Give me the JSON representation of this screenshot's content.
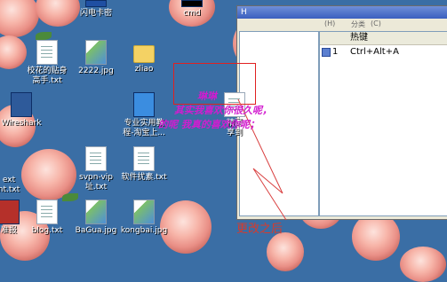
{
  "desktop": {
    "icons": [
      {
        "label": "闪电卡密",
        "type": "exe"
      },
      {
        "label": "cmd",
        "type": "exe"
      },
      {
        "label": "校花的贴身\n高手.txt",
        "type": "doc"
      },
      {
        "label": "2222.jpg",
        "type": "img"
      },
      {
        "label": "zliao",
        "type": "folder"
      },
      {
        "label": "Wireshark",
        "type": "exe"
      },
      {
        "label": "专业实用教\n程-淘宝上...",
        "type": "exe"
      },
      {
        "label": "精哥\n享到",
        "type": "doc"
      },
      {
        "label": "ext\nnt.txt",
        "type": "doc"
      },
      {
        "label": "svpn-vip\n址.txt",
        "type": "doc"
      },
      {
        "label": "软件扰素.txt",
        "type": "doc"
      },
      {
        "label": "准报",
        "type": "exe"
      },
      {
        "label": "blog.txt",
        "type": "doc"
      },
      {
        "label": "BaGua.jpg",
        "type": "img"
      },
      {
        "label": "kongbai.jpg",
        "type": "img"
      }
    ]
  },
  "window": {
    "title": "H",
    "menu": [
      "(H)",
      "分类",
      "(C)"
    ],
    "list": {
      "header": "热键",
      "rows": [
        {
          "index": "1",
          "hotkey": "Ctrl+Alt+A"
        }
      ]
    }
  },
  "annotation": {
    "handwriting": {
      "line1": "琳琳",
      "line2": "其实我喜欢你很久呢，",
      "line3": "的呢  我真的喜欢你呢；"
    },
    "caption": "更改之后"
  },
  "colors": {
    "desktop_bg": "#3a6ea5",
    "handwriting": "#d21ccf",
    "highlight_box": "#e02020",
    "caption": "#d93a2a"
  }
}
